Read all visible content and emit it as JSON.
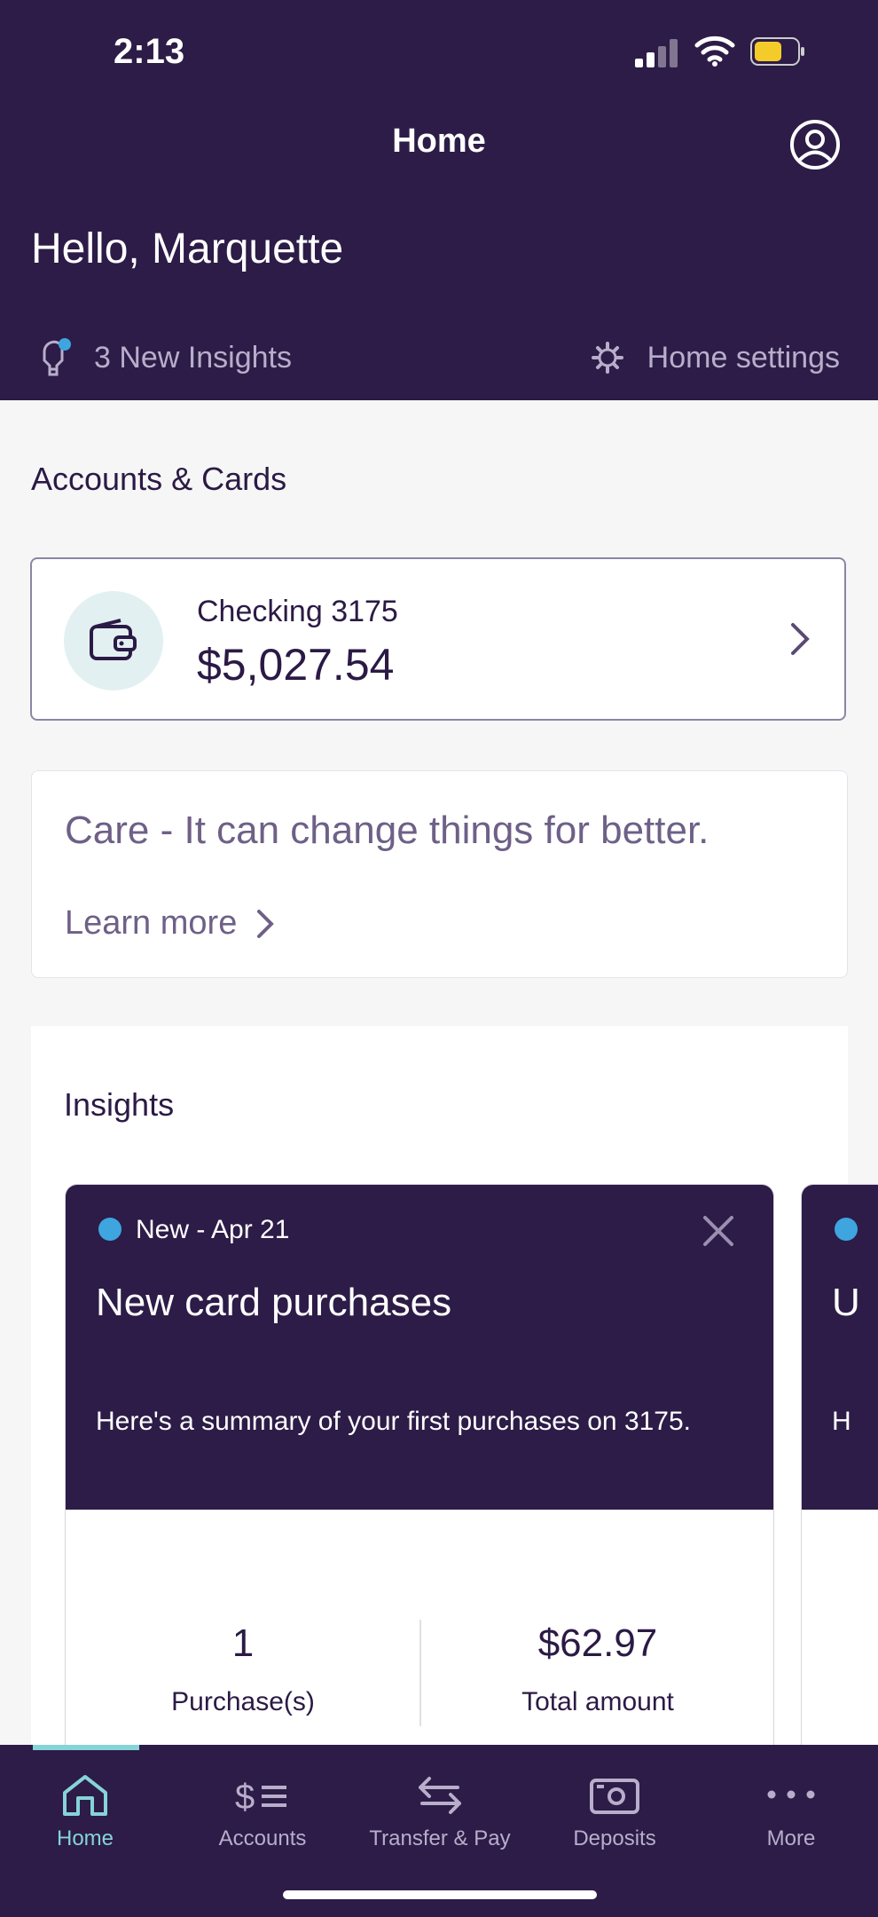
{
  "status_bar": {
    "time": "2:13"
  },
  "header": {
    "title": "Home",
    "greeting": "Hello, Marquette",
    "insights_link": "3 New Insights",
    "settings_link": "Home settings"
  },
  "accounts": {
    "section_title": "Accounts & Cards",
    "items": [
      {
        "name": "Checking 3175",
        "balance": "$5,027.54"
      }
    ]
  },
  "promo": {
    "title": "Care - It can change things for better.",
    "link": "Learn more"
  },
  "insights": {
    "section_title": "Insights",
    "cards": [
      {
        "status": "New - Apr 21",
        "title": "New card purchases",
        "description": "Here's a summary of your first purchases on  3175.",
        "stats": [
          {
            "value": "1",
            "label": "Purchase(s)"
          },
          {
            "value": "$62.97",
            "label": "Total amount"
          }
        ]
      }
    ],
    "next_card_preview": {
      "title": "U",
      "description": "H"
    }
  },
  "tab_bar": {
    "items": [
      {
        "label": "Home",
        "icon": "home-icon",
        "active": true
      },
      {
        "label": "Accounts",
        "icon": "accounts-icon",
        "active": false
      },
      {
        "label": "Transfer & Pay",
        "icon": "transfer-icon",
        "active": false
      },
      {
        "label": "Deposits",
        "icon": "deposit-icon",
        "active": false
      },
      {
        "label": "More",
        "icon": "more-dots-icon",
        "active": false
      }
    ]
  },
  "colors": {
    "brand_purple": "#2c1c47",
    "accent_teal": "#86d3d8",
    "new_dot_blue": "#3ea5df",
    "battery_yellow": "#f4cc2a"
  }
}
